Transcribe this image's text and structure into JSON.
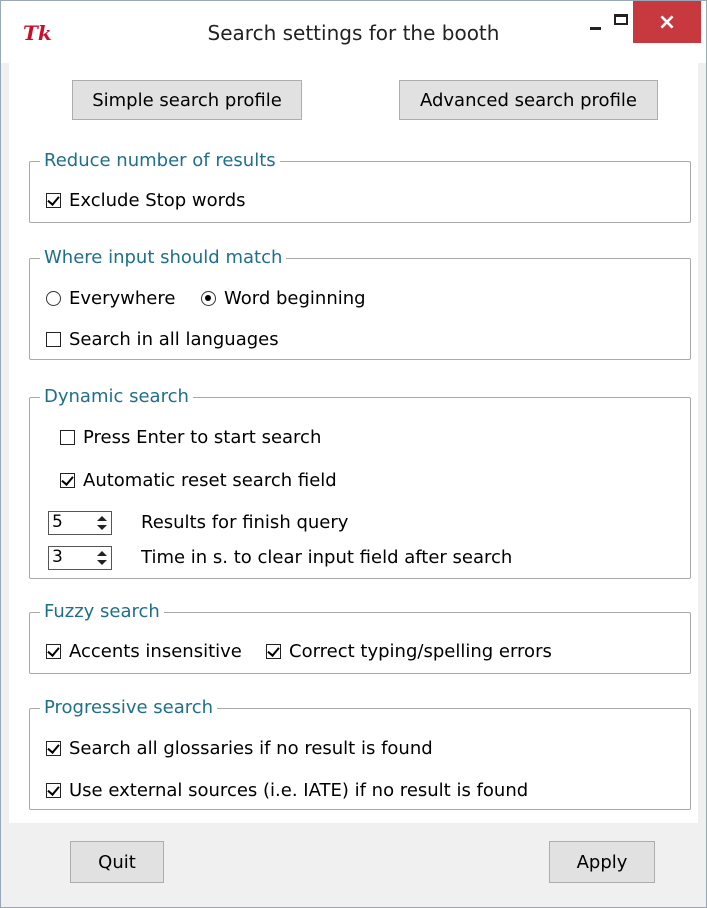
{
  "window": {
    "title": "Search settings for the booth",
    "logo": "Tk",
    "minimize_icon": "minimize-icon",
    "maximize_icon": "maximize-icon",
    "close_icon": "close-icon",
    "close_glyph": "×"
  },
  "profiles": {
    "simple_label": "Simple search profile",
    "advanced_label": "Advanced search profile"
  },
  "reduce": {
    "title": "Reduce number of results",
    "exclude_stop_words": {
      "label": "Exclude Stop words",
      "checked": true
    }
  },
  "match": {
    "title": "Where input should match",
    "everywhere_label": "Everywhere",
    "word_beginning_label": "Word beginning",
    "selected": "Word beginning",
    "all_languages": {
      "label": "Search in all languages",
      "checked": false
    }
  },
  "dynamic": {
    "title": "Dynamic search",
    "press_enter": {
      "label": "Press Enter to start search",
      "checked": false
    },
    "auto_reset": {
      "label": "Automatic reset search field",
      "checked": true
    },
    "results_count": {
      "value": "5",
      "label": "Results for finish query"
    },
    "clear_time": {
      "value": "3",
      "label": "Time in s. to clear input field after search"
    }
  },
  "fuzzy": {
    "title": "Fuzzy search",
    "accents": {
      "label": "Accents insensitive",
      "checked": true
    },
    "typing": {
      "label": "Correct typing/spelling errors",
      "checked": true
    }
  },
  "progressive": {
    "title": "Progressive search",
    "all_glossaries": {
      "label": "Search all glossaries if no result is found",
      "checked": true
    },
    "external": {
      "label": "Use external sources (i.e. IATE) if no result is found",
      "checked": true
    }
  },
  "footer": {
    "quit_label": "Quit",
    "apply_label": "Apply"
  }
}
